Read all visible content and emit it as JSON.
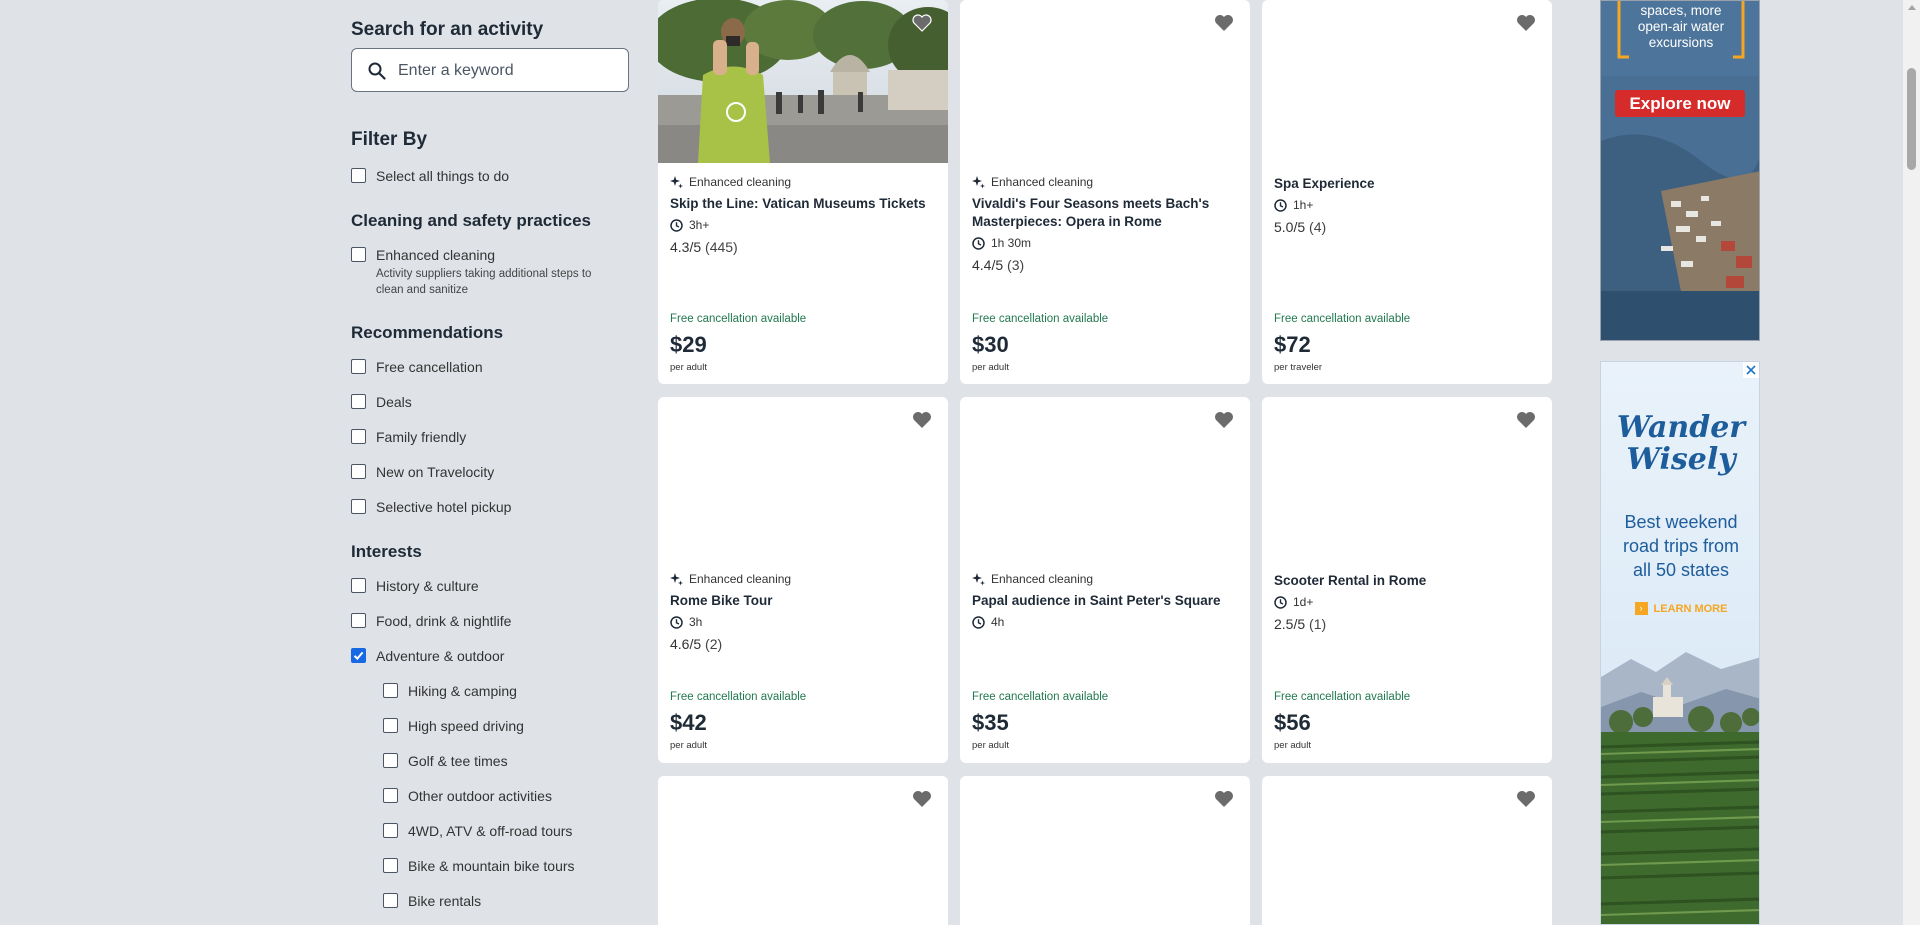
{
  "sidebar": {
    "search_title": "Search for an activity",
    "search_placeholder": "Enter a keyword",
    "filter_by": "Filter By",
    "select_all": "Select all things to do",
    "cleaning_heading": "Cleaning and safety practices",
    "enhanced_cleaning": "Enhanced cleaning",
    "enhanced_cleaning_desc": "Activity suppliers taking additional steps to clean and sanitize",
    "recommendations_heading": "Recommendations",
    "recommendations": [
      "Free cancellation",
      "Deals",
      "Family friendly",
      "New on Travelocity",
      "Selective hotel pickup"
    ],
    "interests_heading": "Interests",
    "interests": [
      {
        "label": "History & culture",
        "checked": false
      },
      {
        "label": "Food, drink & nightlife",
        "checked": false
      },
      {
        "label": "Adventure & outdoor",
        "checked": true
      }
    ],
    "sub_interests": [
      "Hiking & camping",
      "High speed driving",
      "Golf & tee times",
      "Other outdoor activities",
      "4WD, ATV & off-road tours",
      "Bike & mountain bike tours",
      "Bike rentals"
    ]
  },
  "cards": [
    {
      "badge": "Enhanced cleaning",
      "title": "Skip the Line: Vatican Museums Tickets",
      "duration": "3h+",
      "rating": "4.3/5",
      "reviews": "(445)",
      "free_cancel": "Free cancellation available",
      "price": "$29",
      "unit": "per adult"
    },
    {
      "badge": "Enhanced cleaning",
      "title": "Vivaldi's Four Seasons meets Bach's Masterpieces: Opera in Rome",
      "duration": "1h 30m",
      "rating": "4.4/5",
      "reviews": "(3)",
      "free_cancel": "Free cancellation available",
      "price": "$30",
      "unit": "per adult"
    },
    {
      "badge": "",
      "title": "Spa Experience",
      "duration": "1h+",
      "rating": "5.0/5",
      "reviews": "(4)",
      "free_cancel": "Free cancellation available",
      "price": "$72",
      "unit": "per traveler"
    },
    {
      "badge": "Enhanced cleaning",
      "title": "Rome Bike Tour",
      "duration": "3h",
      "rating": "4.6/5",
      "reviews": "(2)",
      "free_cancel": "Free cancellation available",
      "price": "$42",
      "unit": "per adult"
    },
    {
      "badge": "Enhanced cleaning",
      "title": "Papal audience in Saint Peter's Square",
      "duration": "4h",
      "rating": "",
      "reviews": "",
      "free_cancel": "Free cancellation available",
      "price": "$35",
      "unit": "per adult"
    },
    {
      "badge": "",
      "title": "Scooter Rental in Rome",
      "duration": "1d+",
      "rating": "2.5/5",
      "reviews": "(1)",
      "free_cancel": "Free cancellation available",
      "price": "$56",
      "unit": "per adult"
    }
  ],
  "ad1": {
    "text_lines": [
      "spaces, more",
      "open-air water",
      "excursions"
    ],
    "button": "Explore now"
  },
  "ad2": {
    "brand_line1": "Wander",
    "brand_line2": "Wisely",
    "tagline_lines": [
      "Best weekend",
      "road trips from",
      "all 50 states"
    ],
    "cta": "LEARN MORE"
  },
  "colors": {
    "accent_blue": "#1668e3",
    "free_cancel_green": "#227950",
    "ad_red": "#d62b2b",
    "ad_orange": "#f5a623"
  }
}
